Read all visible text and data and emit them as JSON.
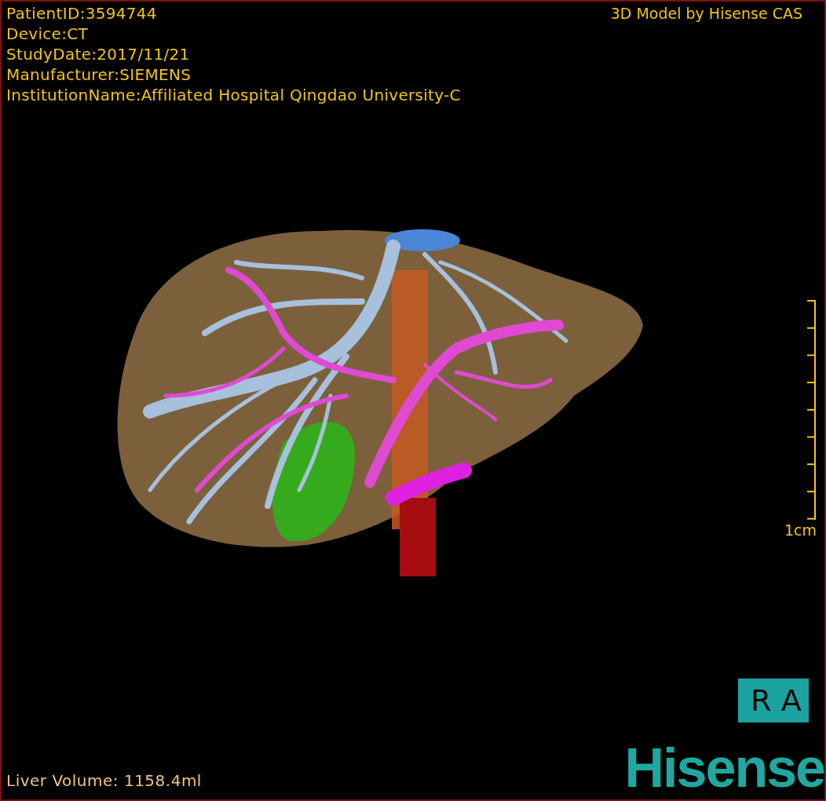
{
  "info_lines": [
    "PatientID:3594744",
    "Device:CT",
    "StudyDate:2017/11/21",
    "Manufacturer:SIEMENS",
    "InstitutionName:Affiliated Hospital Qingdao University-C"
  ],
  "title": "3D Model by Hisense CAS",
  "scale": {
    "label": "1cm"
  },
  "orientation": "RA",
  "liver_volume": "Liver Volume: 1158.4ml",
  "logo": "Hisense"
}
